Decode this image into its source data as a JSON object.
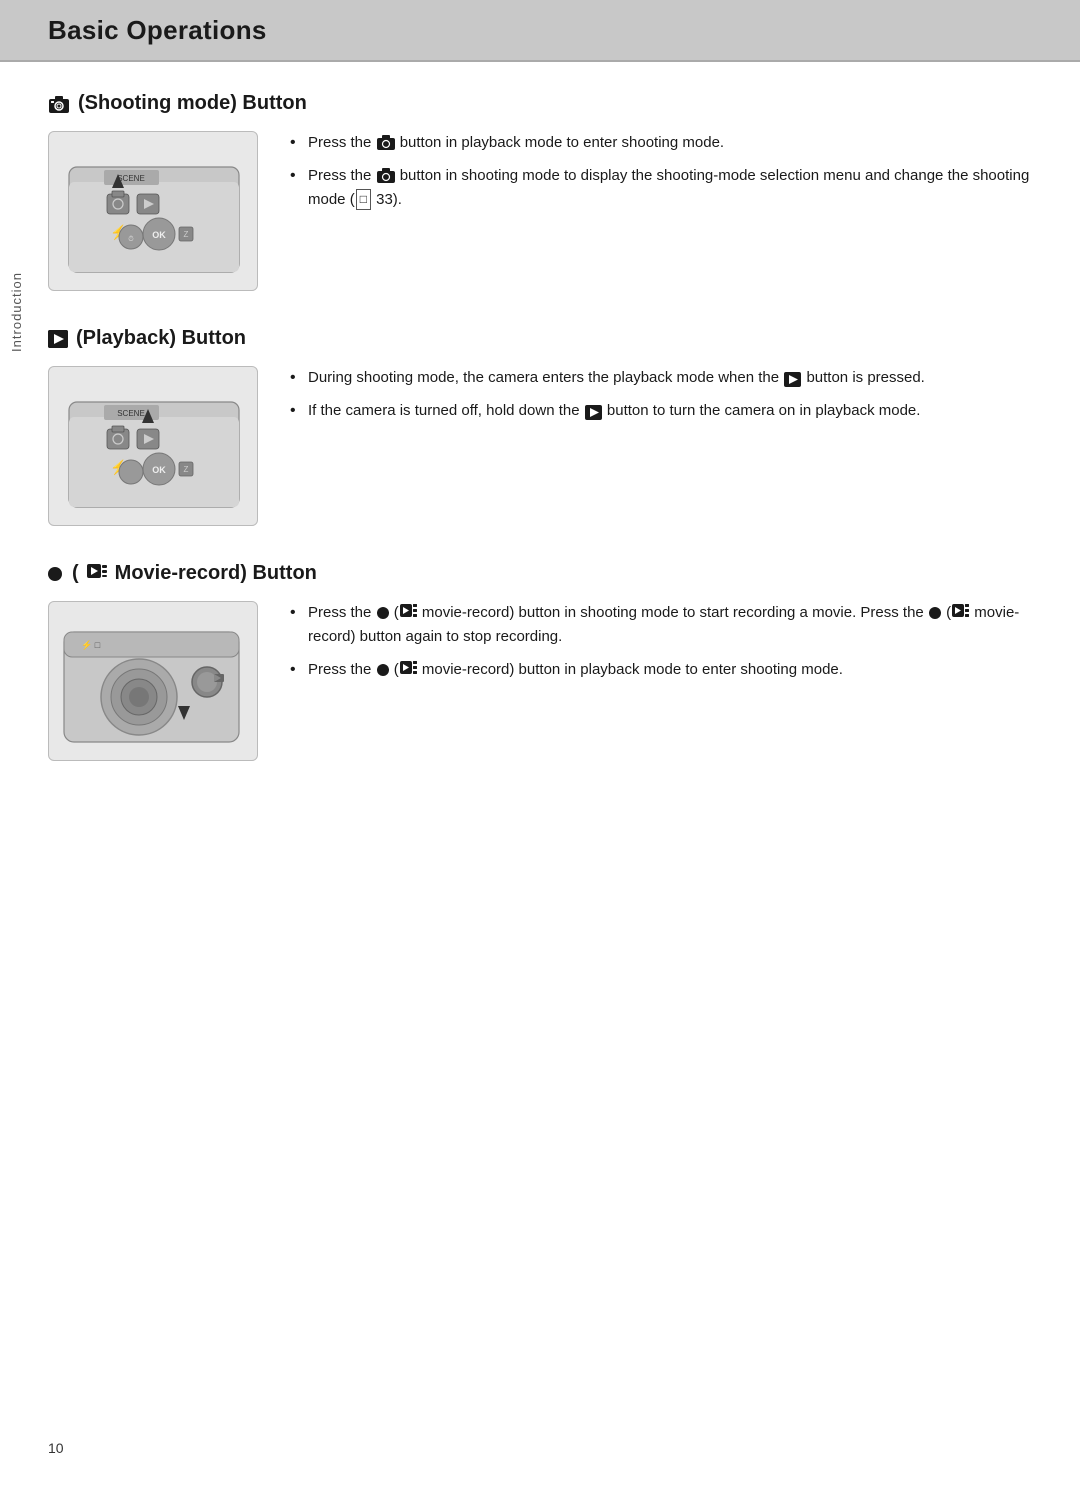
{
  "header": {
    "title": "Basic Operations"
  },
  "sidebar": {
    "label": "Introduction"
  },
  "page_number": "10",
  "sections": [
    {
      "id": "shooting-mode",
      "title_prefix": "🔲",
      "title": "(Shooting mode) Button",
      "bullets": [
        {
          "text_parts": [
            "Press the ",
            "[shooting-icon]",
            " button in playback mode to enter shooting mode."
          ]
        },
        {
          "text_parts": [
            "Press the ",
            "[shooting-icon]",
            " button in shooting mode to display the shooting-mode selection menu and change the shooting mode (",
            "[ref:33]",
            " 33)."
          ]
        }
      ]
    },
    {
      "id": "playback",
      "title_prefix": "▶",
      "title": "(Playback) Button",
      "bullets": [
        {
          "text_parts": [
            "During shooting mode, the camera enters the playback mode when the ",
            "[playback-icon]",
            " button is pressed."
          ]
        },
        {
          "text_parts": [
            "If the camera is turned off, hold down the ",
            "[playback-icon]",
            " button to turn the camera on in playback mode."
          ]
        }
      ]
    },
    {
      "id": "movie-record",
      "title_prefix": "●",
      "title": "(★ Movie-record) Button",
      "bullets": [
        {
          "text_parts": [
            "Press the ",
            "[movie-btn]",
            " (",
            "[movie-icon]",
            " movie-record) button in shooting mode to start recording a movie. Press the ",
            "[movie-btn]",
            " (",
            "[movie-icon]",
            " movie-record) button again to stop recording."
          ]
        },
        {
          "text_parts": [
            "Press the ",
            "[movie-btn]",
            " (",
            "[movie-icon]",
            " movie-record) button in playback mode to enter shooting mode."
          ]
        }
      ]
    }
  ]
}
